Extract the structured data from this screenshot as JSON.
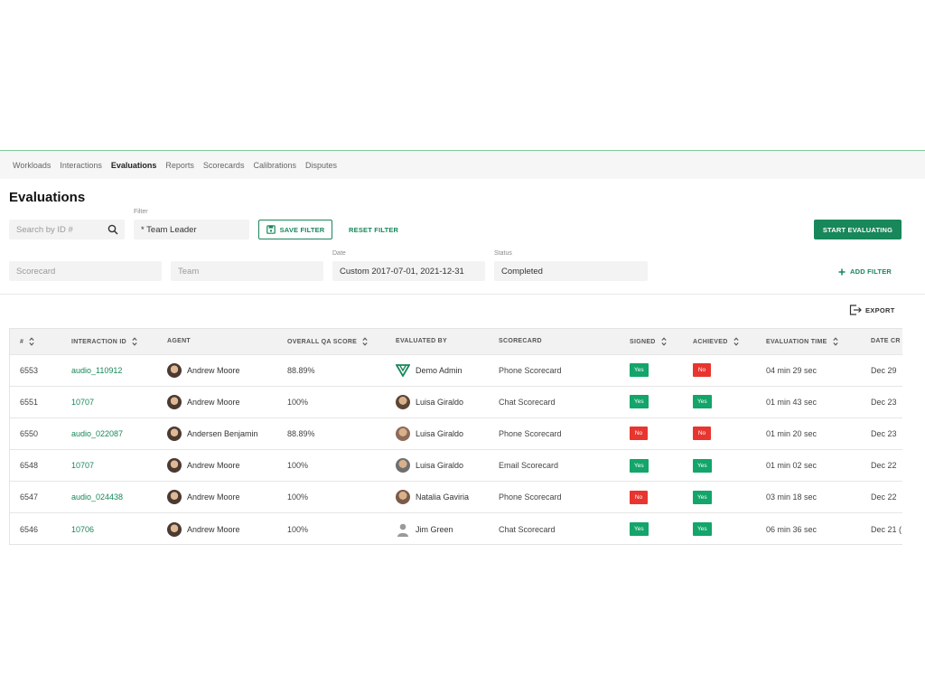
{
  "nav": {
    "items": [
      "Workloads",
      "Interactions",
      "Evaluations",
      "Reports",
      "Scorecards",
      "Calibrations",
      "Disputes"
    ],
    "active": "Evaluations"
  },
  "page": {
    "title": "Evaluations"
  },
  "filters": {
    "search_placeholder": "Search by ID #",
    "filter_label": "Filter",
    "filter_value": "* Team Leader",
    "save_filter": "SAVE FILTER",
    "reset_filter": "RESET FILTER",
    "start_evaluating": "START EVALUATING",
    "scorecard_placeholder": "Scorecard",
    "team_placeholder": "Team",
    "date_label": "Date",
    "date_value": "Custom 2017-07-01, 2021-12-31",
    "status_label": "Status",
    "status_value": "Completed",
    "add_filter": "ADD FILTER"
  },
  "export_label": "EXPORT",
  "colors": {
    "accent": "#18875a",
    "yes": "#13a56a",
    "no": "#e8352f"
  },
  "table": {
    "columns": [
      "#",
      "INTERACTION ID",
      "AGENT",
      "OVERALL QA SCORE",
      "EVALUATED BY",
      "SCORECARD",
      "SIGNED",
      "ACHIEVED",
      "EVALUATION TIME",
      "DATE CR"
    ],
    "rows": [
      {
        "id": "6553",
        "interaction": "audio_110912",
        "agent": "Andrew Moore",
        "score": "88.89%",
        "evaluator": "Demo Admin",
        "evaluator_icon": "brand-logo-icon",
        "scorecard": "Phone Scorecard",
        "signed": "Yes",
        "achieved": "No",
        "time": "04 min 29 sec",
        "date": "Dec 29"
      },
      {
        "id": "6551",
        "interaction": "10707",
        "agent": "Andrew Moore",
        "score": "100%",
        "evaluator": "Luisa Giraldo",
        "evaluator_icon": "avatar",
        "scorecard": "Chat Scorecard",
        "signed": "Yes",
        "achieved": "Yes",
        "time": "01 min 43 sec",
        "date": "Dec 23"
      },
      {
        "id": "6550",
        "interaction": "audio_022087",
        "agent": "Andersen Benjamin",
        "score": "88.89%",
        "evaluator": "Luisa Giraldo",
        "evaluator_icon": "avatar",
        "scorecard": "Phone Scorecard",
        "signed": "No",
        "achieved": "No",
        "time": "01 min 20 sec",
        "date": "Dec 23"
      },
      {
        "id": "6548",
        "interaction": "10707",
        "agent": "Andrew Moore",
        "score": "100%",
        "evaluator": "Luisa Giraldo",
        "evaluator_icon": "avatar",
        "scorecard": "Email Scorecard",
        "signed": "Yes",
        "achieved": "Yes",
        "time": "01 min 02 sec",
        "date": "Dec 22"
      },
      {
        "id": "6547",
        "interaction": "audio_024438",
        "agent": "Andrew Moore",
        "score": "100%",
        "evaluator": "Natalia Gaviria",
        "evaluator_icon": "avatar",
        "scorecard": "Phone Scorecard",
        "signed": "No",
        "achieved": "Yes",
        "time": "03 min 18 sec",
        "date": "Dec 22"
      },
      {
        "id": "6546",
        "interaction": "10706",
        "agent": "Andrew Moore",
        "score": "100%",
        "evaluator": "Jim Green",
        "evaluator_icon": "default-user-icon",
        "scorecard": "Chat Scorecard",
        "signed": "Yes",
        "achieved": "Yes",
        "time": "06 min 36 sec",
        "date": "Dec 21 ("
      }
    ]
  }
}
